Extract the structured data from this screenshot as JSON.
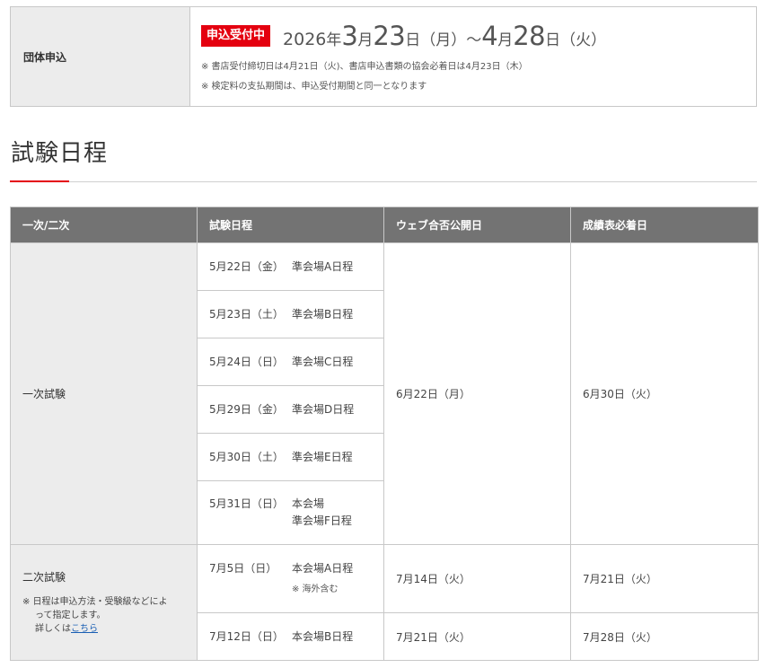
{
  "group_apply": {
    "label": "団体申込",
    "badge": "申込受付中",
    "start_year": "2026",
    "start_year_unit": "年",
    "start_month": "3",
    "start_month_unit": "月",
    "start_day": "23",
    "start_day_unit": "日",
    "start_weekday": "（月）",
    "tilde": "～",
    "end_month": "4",
    "end_month_unit": "月",
    "end_day": "28",
    "end_day_unit": "日",
    "end_weekday": "（火）",
    "notes": [
      "※ 書店受付締切日は4月21日（火)、書店申込書類の協会必着日は4月23日（木）",
      "※ 検定料の支払期間は、申込受付期間と同一となります"
    ]
  },
  "schedule": {
    "title": "試験日程",
    "headers": [
      "一次/二次",
      "試験日程",
      "ウェブ合否公開日",
      "成績表必着日"
    ],
    "first": {
      "category": "一次試験",
      "web_date": "6月22日（月）",
      "report_date": "6月30日（火）",
      "rows": [
        {
          "date": "5月22日（金）",
          "venue": "準会場A日程"
        },
        {
          "date": "5月23日（土）",
          "venue": "準会場B日程"
        },
        {
          "date": "5月24日（日）",
          "venue": "準会場C日程"
        },
        {
          "date": "5月29日（金）",
          "venue": "準会場D日程"
        },
        {
          "date": "5月30日（土）",
          "venue": "準会場E日程"
        },
        {
          "date": "5月31日（日）",
          "venue": "本会場",
          "venue2": "準会場F日程"
        }
      ]
    },
    "second": {
      "category": "二次試験",
      "note_line1": "※ 日程は申込方法・受験級などによ",
      "note_line2": "って指定します。",
      "note_line3_prefix": "詳しくは",
      "note_link": "こちら",
      "rows": [
        {
          "date": "7月5日（日）",
          "venue": "本会場A日程",
          "venue_note": "※ 海外含む",
          "web_date": "7月14日（火）",
          "report_date": "7月21日（火）"
        },
        {
          "date": "7月12日（日）",
          "venue": "本会場B日程",
          "web_date": "7月21日（火）",
          "report_date": "7月28日（火）"
        }
      ]
    }
  }
}
